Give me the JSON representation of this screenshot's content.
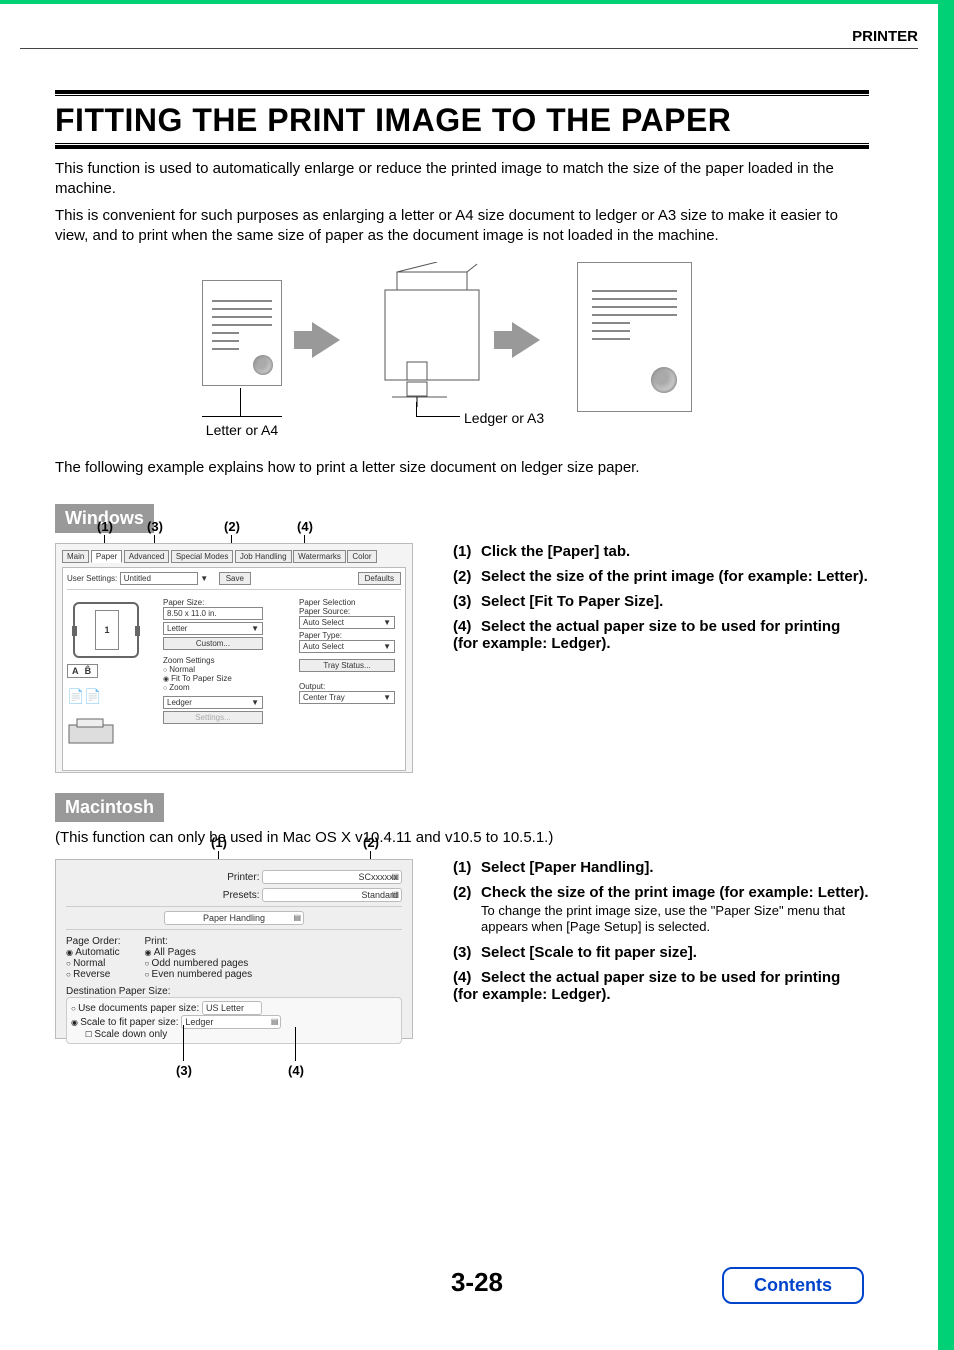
{
  "header": {
    "section": "PRINTER"
  },
  "title": "FITTING THE PRINT IMAGE TO THE PAPER",
  "intro1": "This function is used to automatically enlarge or reduce the printed image to match the size of the paper loaded in the machine.",
  "intro2": "This is convenient for such purposes as enlarging a letter or A4 size document to ledger or A3 size to make it easier to view, and to print when the same size of paper as the document image is not loaded in the machine.",
  "diagram": {
    "cap_left": "Letter or A4",
    "cap_right": "Ledger or A3"
  },
  "followup": "The following example explains how to print a letter size document on ledger size paper.",
  "windows": {
    "label": "Windows",
    "callouts": [
      "(1)",
      "(3)",
      "(2)",
      "(4)"
    ],
    "shot": {
      "tabs": [
        "Main",
        "Paper",
        "Advanced",
        "Special Modes",
        "Job Handling",
        "Watermarks",
        "Color"
      ],
      "user_settings": "User Settings:",
      "user_value": "Untitled",
      "save": "Save",
      "defaults": "Defaults",
      "paper_size_label": "Paper Size:",
      "size_inches": "8.50 x 11.0 in.",
      "size_name": "Letter",
      "custom": "Custom...",
      "zoom_settings": "Zoom Settings",
      "normal": "Normal",
      "fit": "Fit To Paper Size",
      "zoom": "Zoom",
      "fit_value": "Ledger",
      "settings_btn": "Settings...",
      "paper_selection": "Paper Selection",
      "paper_source": "Paper Source:",
      "auto_select": "Auto Select",
      "paper_type": "Paper Type:",
      "tray_status": "Tray Status...",
      "output": "Output:",
      "center_tray": "Center Tray",
      "ab": "A  B̂",
      "one": "1"
    },
    "steps": [
      {
        "n": "(1)",
        "t": "Click the [Paper] tab."
      },
      {
        "n": "(2)",
        "t": "Select the size of the print image (for example: Letter)."
      },
      {
        "n": "(3)",
        "t": "Select [Fit To Paper Size]."
      },
      {
        "n": "(4)",
        "t": "Select the actual paper size to be used for printing (for example: Ledger)."
      }
    ]
  },
  "mac": {
    "label": "Macintosh",
    "note": "(This function can only be used in Mac OS X v10.4.11 and v10.5 to 10.5.1.)",
    "callouts_top": [
      "(1)",
      "(2)"
    ],
    "callouts_bottom": [
      "(3)",
      "(4)"
    ],
    "shot": {
      "printer_lbl": "Printer:",
      "printer_val": "SCxxxxxx",
      "presets_lbl": "Presets:",
      "presets_val": "Standard",
      "pane": "Paper Handling",
      "page_order": "Page Order:",
      "automatic": "Automatic",
      "normal": "Normal",
      "reverse": "Reverse",
      "print": "Print:",
      "all": "All Pages",
      "odd": "Odd numbered pages",
      "even": "Even numbered pages",
      "dest": "Destination Paper Size:",
      "use_doc": "Use documents paper size:",
      "use_doc_val": "US Letter",
      "scale": "Scale to fit paper size:",
      "scale_val": "Ledger",
      "scale_down": "Scale down only"
    },
    "steps": [
      {
        "n": "(1)",
        "t": "Select [Paper Handling]."
      },
      {
        "n": "(2)",
        "t": "Check the size of the print image (for example: Letter).",
        "sub": "To change the print image size, use the \"Paper Size\" menu that appears when [Page Setup] is selected."
      },
      {
        "n": "(3)",
        "t": "Select [Scale to fit paper size]."
      },
      {
        "n": "(4)",
        "t": "Select the actual paper size to be used for printing (for example: Ledger)."
      }
    ]
  },
  "page_number": "3-28",
  "contents": "Contents"
}
